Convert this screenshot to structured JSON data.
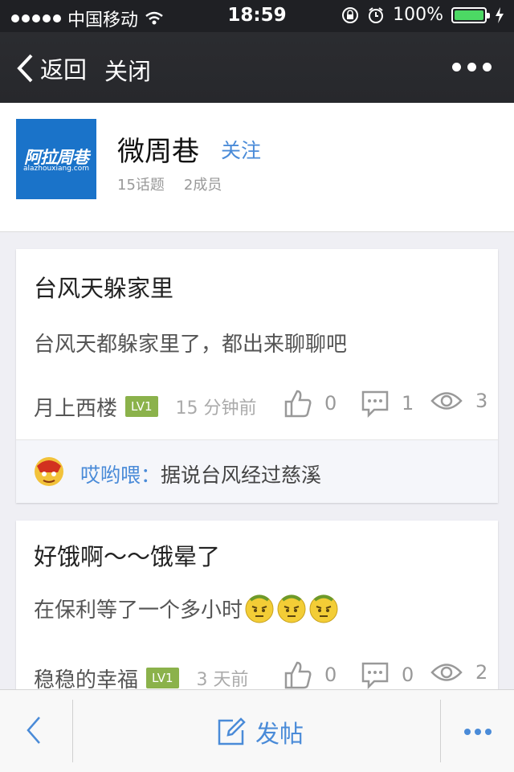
{
  "status": {
    "carrier": "中国移动",
    "time": "18:59",
    "battery": "100%",
    "battery_level": 1.0
  },
  "nav": {
    "back_label": "返回",
    "close_label": "关闭"
  },
  "group": {
    "logo_text": "阿拉周巷",
    "logo_url": "alazhouxiang.com",
    "name": "微周巷",
    "follow_label": "关注",
    "topics": "15话题",
    "members": "2成员"
  },
  "posts": [
    {
      "title": "台风天躲家里",
      "body": "台风天都躲家里了，都出来聊聊吧",
      "author": "月上西楼",
      "level": "LV1",
      "time": "15 分钟前",
      "likes": "0",
      "comments": "1",
      "views": "3",
      "reply": {
        "user": "哎哟喂：",
        "text": "据说台风经过慈溪"
      }
    },
    {
      "title": "好饿啊～～饿晕了",
      "body": "在保利等了一个多小时",
      "author": "稳稳的幸福",
      "level": "LV1",
      "time": "3 天前",
      "likes": "0",
      "comments": "0",
      "views": "2"
    }
  ],
  "toolbar": {
    "post_label": "发帖"
  },
  "colors": {
    "accent": "#4a8bd8",
    "level_badge": "#8bb24b",
    "nav_bg": "#27282c"
  }
}
